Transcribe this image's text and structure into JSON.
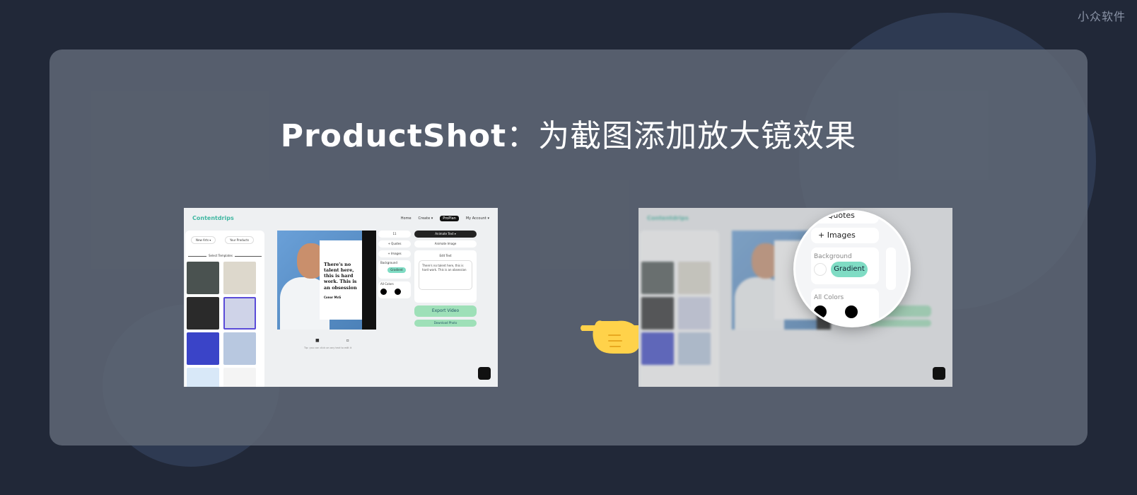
{
  "watermark": "小众软件",
  "title": {
    "brand": "ProductShot",
    "rest": "：为截图添加放大镜效果"
  },
  "app": {
    "logo": "Contentdrips",
    "nav": [
      "Home",
      "Create ▾",
      "ProPlan",
      "My Account ▾"
    ],
    "left_buttons": [
      "New Arts ▾",
      "Your Products"
    ],
    "select_templates": "Select Templates",
    "quote": "There's no talent here, this is hard work. This is an obsession",
    "author": "Conor McG",
    "caption": "Tip: you can click on any text to edit it",
    "right": {
      "size": "11",
      "quotes": "+ Quotes",
      "images": "+ Images",
      "background": "Background",
      "gradient": "Gradient",
      "all_colors": "All Colors",
      "animate_text": "Animate Text ▾",
      "animate_image": "Animate Image",
      "edit_text": "Edit Text",
      "text_value": "There's no talent here, this is hard work. This is an obsession",
      "export_video": "Export Video",
      "download_photo": "Download Photo"
    }
  },
  "magnifier": {
    "quotes": "+ Quotes",
    "images": "+ Images",
    "background": "Background",
    "gradient": "Gradient",
    "all_colors": "All Colors"
  },
  "colors": {
    "accent": "#3fb7a1",
    "gradient_pill": "#7fdcc4",
    "export": "#9ee0b8",
    "bg": "#212838"
  }
}
